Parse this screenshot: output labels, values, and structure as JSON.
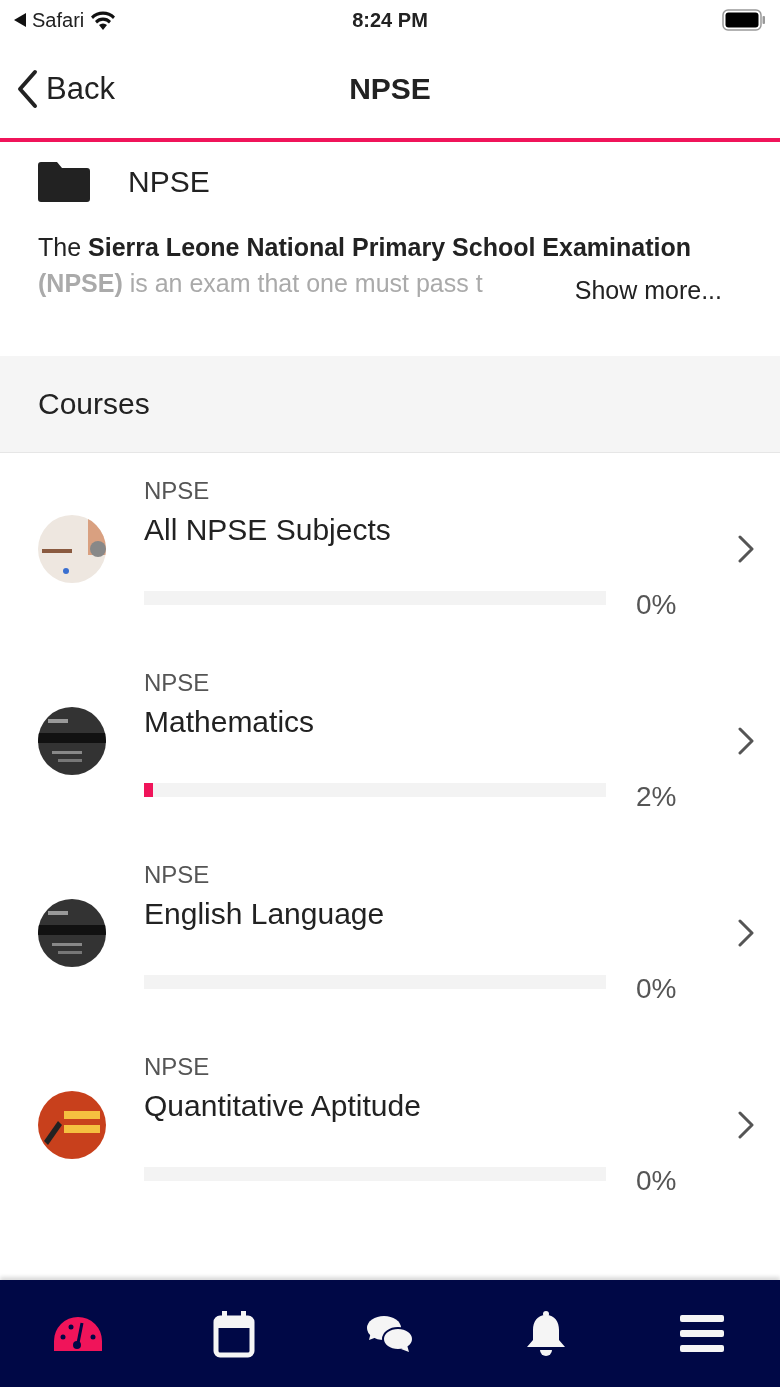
{
  "status_bar": {
    "back_app": "Safari",
    "time": "8:24 PM"
  },
  "nav": {
    "back": "Back",
    "title": "NPSE"
  },
  "folder": {
    "name": "NPSE"
  },
  "description": {
    "lines": [
      {
        "text": "The **Sierra Leone National Primary School Examination**",
        "faded": false
      },
      {
        "text": "**(NPSE)** is an exam that one must pass t",
        "faded": true
      }
    ],
    "show_more": "Show more..."
  },
  "courses_header": "Courses",
  "courses": [
    {
      "category": "NPSE",
      "title": "All NPSE Subjects",
      "level": 0,
      "percent": "0%"
    },
    {
      "category": "NPSE",
      "title": "Mathematics",
      "level": 0.02,
      "percent": "2%"
    },
    {
      "category": "NPSE",
      "title": "English Language",
      "level": 0,
      "percent": "0%"
    },
    {
      "category": "NPSE",
      "title": "Quantitative Aptitude",
      "level": 0,
      "percent": "0%"
    }
  ],
  "tabs": [
    {
      "kind": "dashboard",
      "selected": true
    },
    {
      "kind": "calendar",
      "selected": false
    },
    {
      "kind": "chat",
      "selected": false
    },
    {
      "kind": "bell",
      "selected": false
    },
    {
      "kind": "menu",
      "selected": false
    }
  ]
}
